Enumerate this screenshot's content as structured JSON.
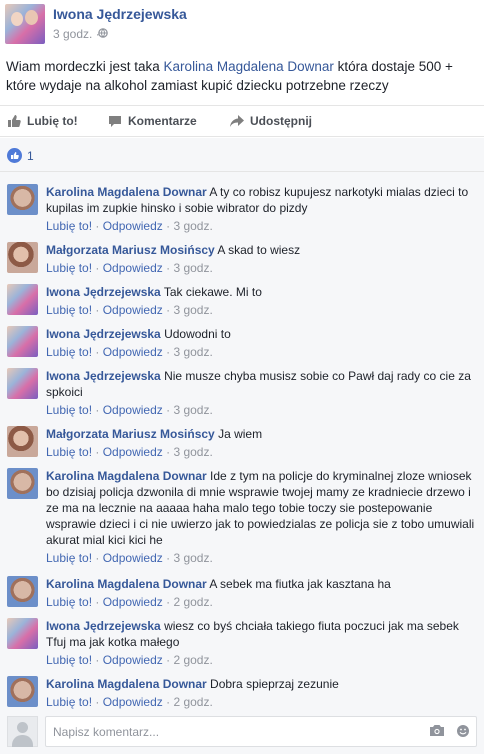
{
  "post": {
    "author": "Iwona Jędrzejewska",
    "time": "3 godz. · ",
    "text_before": "Wiam mordeczki jest taka ",
    "text_link": "Karolina Magdalena Downar",
    "text_after": " która dostaje 500 + które wydaje na alkohol zamiast kupić dziecku potrzebne rzeczy"
  },
  "actions": {
    "like": "Lubię to!",
    "comment": "Komentarze",
    "share": "Udostępnij"
  },
  "likes": {
    "count": "1"
  },
  "comments": [
    {
      "author": "Karolina Magdalena Downar",
      "avatar": "karolina",
      "text": "A ty co robisz kupujesz narkotyki mialas dzieci to kupilas im zupkie hinsko i sobie wibrator do pizdy",
      "like": "Lubię to!",
      "reply": "Odpowiedz",
      "time": "3 godz."
    },
    {
      "author": "Małgorzata Mariusz Mosińscy",
      "avatar": "malgorzata",
      "text": "A skad to wiesz",
      "like": "Lubię to!",
      "reply": "Odpowiedz",
      "time": "3 godz."
    },
    {
      "author": "Iwona Jędrzejewska",
      "avatar": "iwona",
      "text": "Tak ciekawe. Mi to",
      "like": "Lubię to!",
      "reply": "Odpowiedz",
      "time": "3 godz."
    },
    {
      "author": "Iwona Jędrzejewska",
      "avatar": "iwona",
      "text": "Udowodni to",
      "like": "Lubię to!",
      "reply": "Odpowiedz",
      "time": "3 godz."
    },
    {
      "author": "Iwona Jędrzejewska",
      "avatar": "iwona",
      "text": "Nie musze chyba musisz sobie co Pawł daj rady co cie za spkoici",
      "like": "Lubię to!",
      "reply": "Odpowiedz",
      "time": "3 godz."
    },
    {
      "author": "Małgorzata Mariusz Mosińscy",
      "avatar": "malgorzata",
      "text": "Ja wiem",
      "like": "Lubię to!",
      "reply": "Odpowiedz",
      "time": "3 godz."
    },
    {
      "author": "Karolina Magdalena Downar",
      "avatar": "karolina",
      "text": "Ide z tym na policje do kryminalnej zloze wniosek bo dzisiaj policja dzwonila di mnie wsprawie twojej mamy ze kradniecie drzewo i ze ma na lecznie na aaaaa haha malo tego tobie toczy sie postepowanie wsprawie dzieci i ci nie uwierzo jak to powiedzialas ze policja sie z tobo umuwiali akurat mial kici kici he",
      "like": "Lubię to!",
      "reply": "Odpowiedz",
      "time": "3 godz."
    },
    {
      "author": "Karolina Magdalena Downar",
      "avatar": "karolina",
      "text": "A sebek ma fiutka jak kasztana ha",
      "like": "Lubię to!",
      "reply": "Odpowiedz",
      "time": "2 godz."
    },
    {
      "author": "Iwona Jędrzejewska",
      "avatar": "iwona",
      "text": "wiesz co byś chciała takiego fiuta poczuci jak ma sebek Tfuj ma jak kotka małego",
      "like": "Lubię to!",
      "reply": "Odpowiedz",
      "time": "2 godz."
    },
    {
      "author": "Karolina Magdalena Downar",
      "avatar": "karolina",
      "text": "Dobra spieprzaj zezunie",
      "like": "Lubię to!",
      "reply": "Odpowiedz",
      "time": "2 godz."
    }
  ],
  "composer": {
    "placeholder": "Napisz komentarz..."
  },
  "colors": {
    "link": "#365899",
    "meta": "#90949c",
    "like_blue": "#4f7ad8"
  },
  "icons": {
    "privacy": "globe-icon",
    "like": "thumbs-up-icon",
    "comment": "comment-bubble-icon",
    "share": "share-arrow-icon",
    "camera": "camera-icon",
    "sticker": "sticker-icon"
  }
}
